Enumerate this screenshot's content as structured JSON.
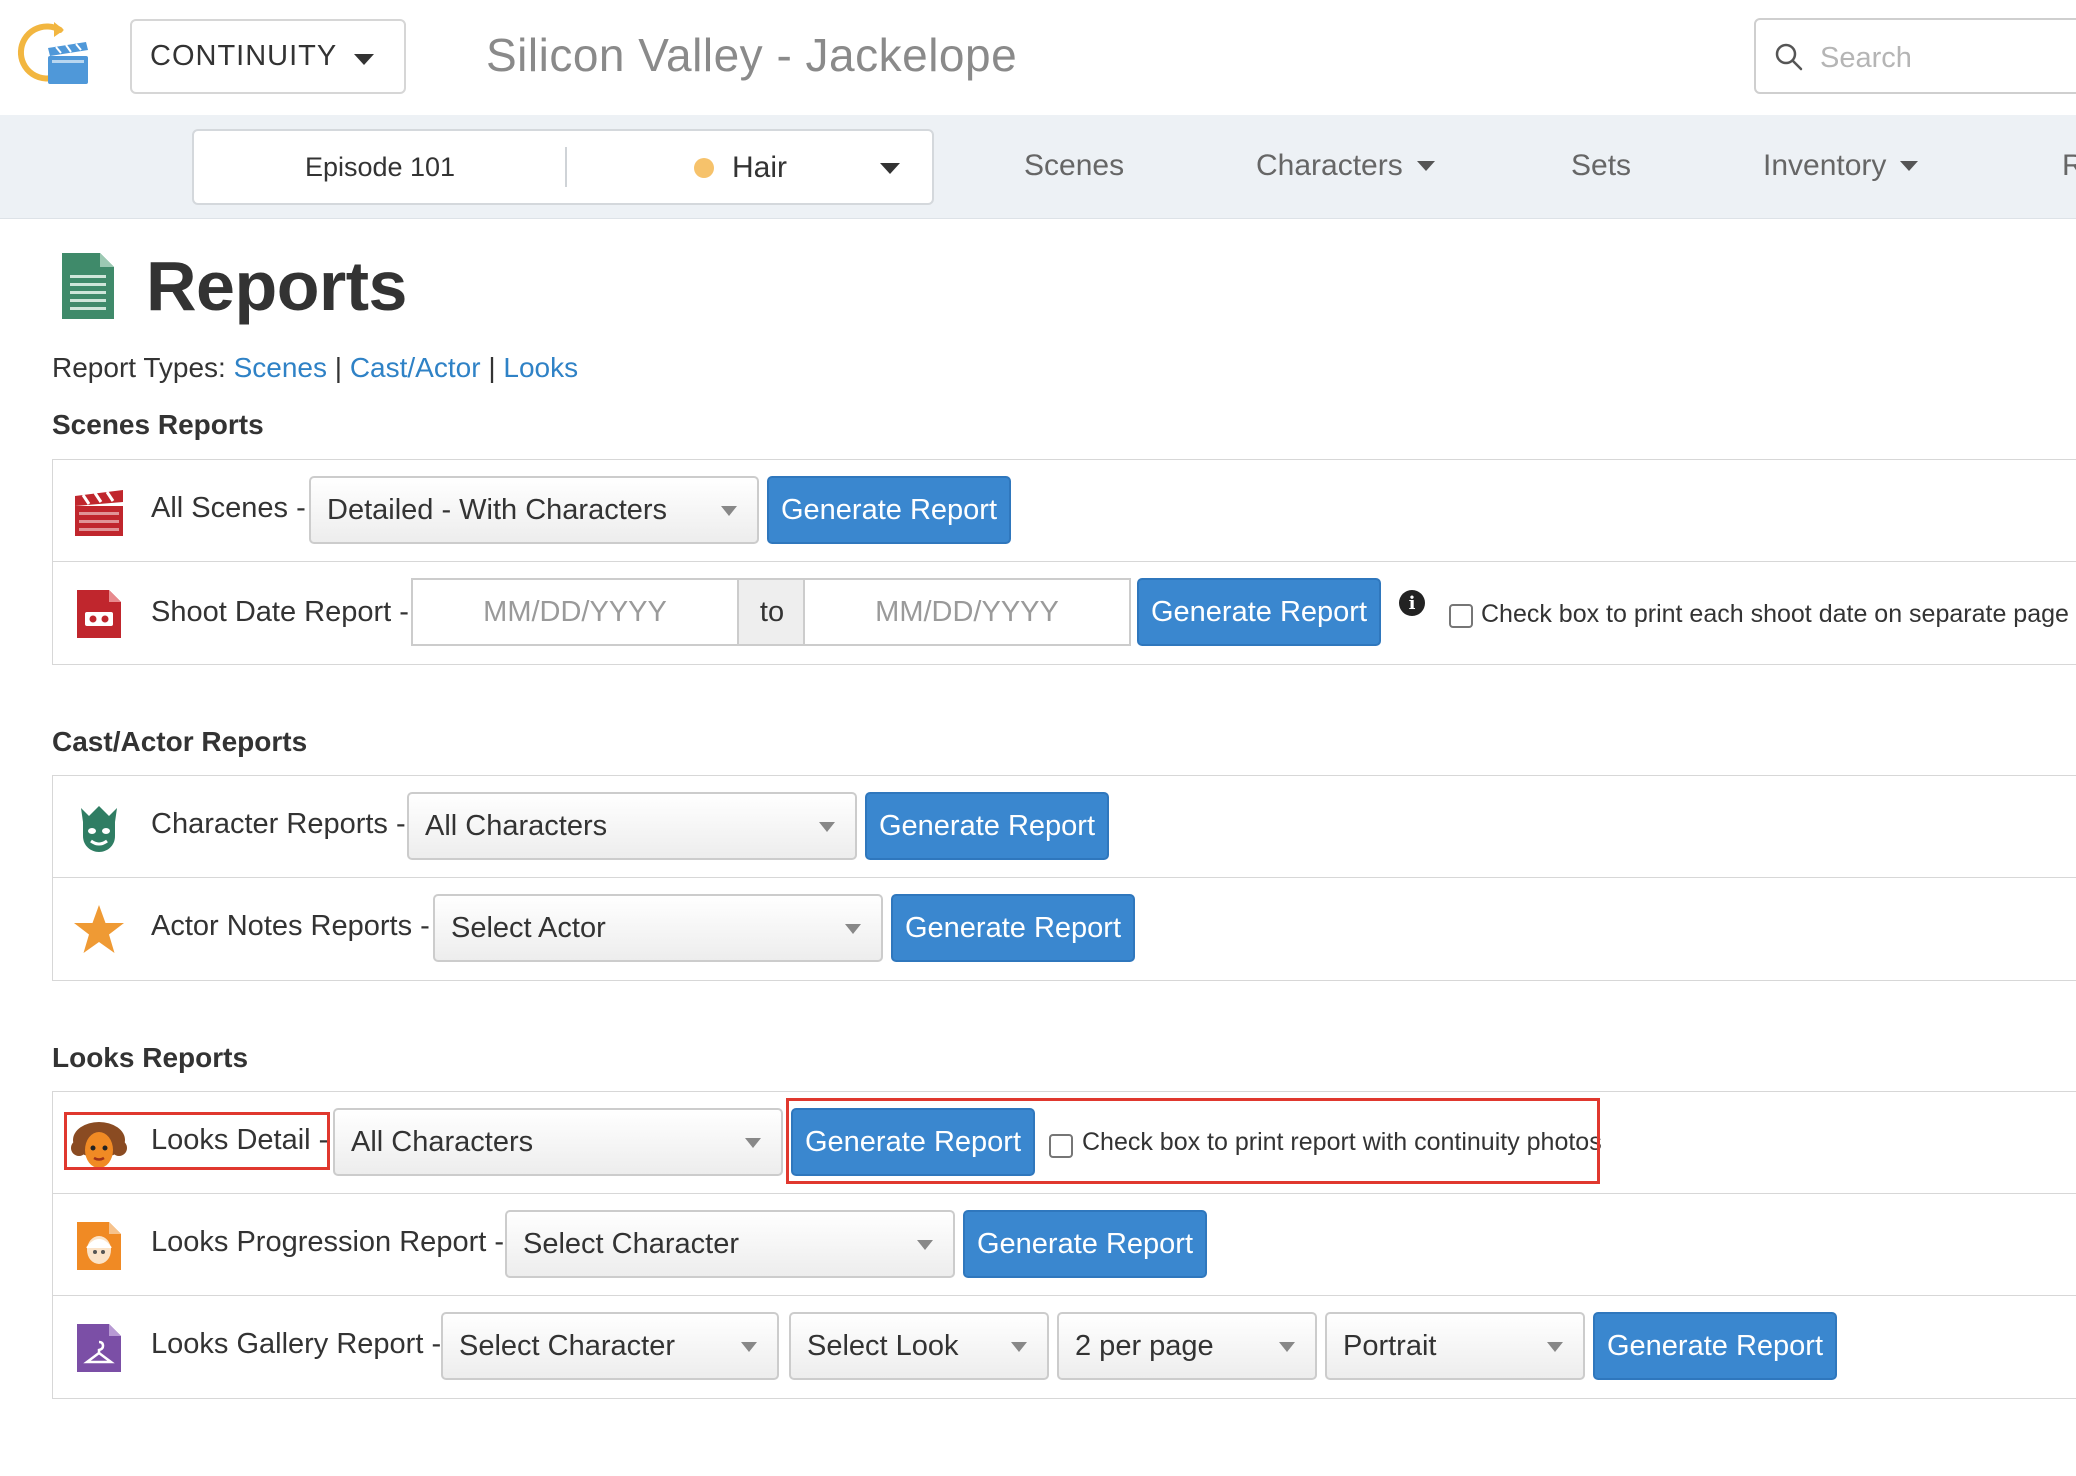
{
  "header": {
    "app_switch_label": "CONTINUITY",
    "project_title": "Silicon Valley - Jackelope",
    "search_placeholder": "Search"
  },
  "subnav": {
    "episode": "Episode 101",
    "department": "Hair",
    "department_dot_color": "#f6c26b",
    "items": [
      {
        "label": "Scenes"
      },
      {
        "label": "Characters"
      },
      {
        "label": "Sets"
      },
      {
        "label": "Inventory"
      },
      {
        "label": "R"
      }
    ]
  },
  "page": {
    "title": "Reports",
    "report_types_prefix": "Report Types:",
    "report_types": [
      "Scenes",
      "Cast/Actor",
      "Looks"
    ],
    "separator": "|"
  },
  "colors": {
    "accent": "#3a87cf",
    "link": "#2f82c6",
    "highlight": "#e0382e"
  },
  "sections": {
    "scenes": {
      "title": "Scenes Reports",
      "all_scenes": {
        "label": "All Scenes -",
        "select_value": "Detailed - With Characters",
        "button": "Generate Report"
      },
      "shoot_date": {
        "label": "Shoot Date Report -",
        "from_placeholder": "MM/DD/YYYY",
        "to_label": "to",
        "to_placeholder": "MM/DD/YYYY",
        "button": "Generate Report",
        "info_glyph": "i",
        "checkbox_label": "Check box to print each shoot date on separate page"
      }
    },
    "cast": {
      "title": "Cast/Actor Reports",
      "character": {
        "label": "Character Reports -",
        "select_value": "All Characters",
        "button": "Generate Report"
      },
      "actor_notes": {
        "label": "Actor Notes Reports -",
        "select_value": "Select Actor",
        "button": "Generate Report"
      }
    },
    "looks": {
      "title": "Looks Reports",
      "detail": {
        "label": "Looks Detail -",
        "select_value": "All Characters",
        "button": "Generate Report",
        "checkbox_label": "Check box to print report with continuity photos"
      },
      "progression": {
        "label": "Looks Progression Report -",
        "select_value": "Select Character",
        "button": "Generate Report"
      },
      "gallery": {
        "label": "Looks Gallery Report -",
        "character_select": "Select Character",
        "look_select": "Select Look",
        "per_page_select": "2 per page",
        "orientation_select": "Portrait",
        "button": "Generate Report"
      }
    }
  }
}
